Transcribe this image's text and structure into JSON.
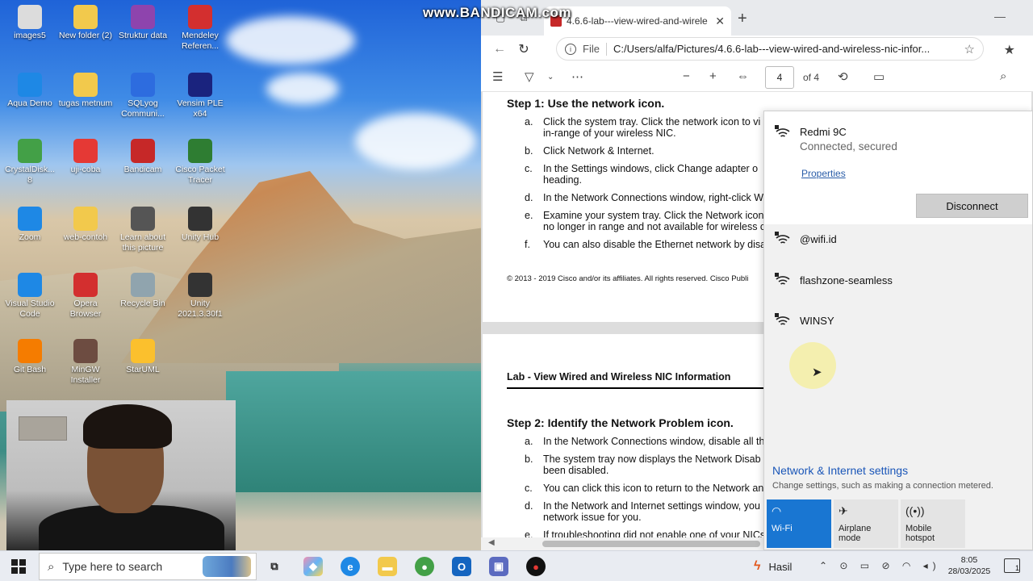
{
  "desktop": {
    "icons": [
      {
        "label": "images5",
        "icon": "image-icon",
        "color": "#dcdcdc"
      },
      {
        "label": "New folder (2)",
        "icon": "folder-icon",
        "color": "#f2c94c"
      },
      {
        "label": "Struktur data",
        "icon": "winrar-icon",
        "color": "#8e44ad"
      },
      {
        "label": "Mendeley Referen...",
        "icon": "mendeley-icon",
        "color": "#d32f2f"
      },
      {
        "label": "Aqua Demo",
        "icon": "aqua-icon",
        "color": "#1e88e5"
      },
      {
        "label": "tugas metnum",
        "icon": "folder-icon",
        "color": "#f2c94c"
      },
      {
        "label": "SQLyog Communi...",
        "icon": "sqlyog-icon",
        "color": "#2d6cdf"
      },
      {
        "label": "Vensim PLE x64",
        "icon": "vensim-icon",
        "color": "#1a237e"
      },
      {
        "label": "CrystalDisk... 8",
        "icon": "crystaldisk-icon",
        "color": "#43a047"
      },
      {
        "label": "uji-coba",
        "icon": "pdf-icon",
        "color": "#e53935"
      },
      {
        "label": "Bandicam",
        "icon": "bandicam-icon",
        "color": "#c62828"
      },
      {
        "label": "Cisco Packet Tracer",
        "icon": "packet-tracer-icon",
        "color": "#2e7d32"
      },
      {
        "label": "Zoom",
        "icon": "zoom-icon",
        "color": "#1e88e5"
      },
      {
        "label": "web-contoh",
        "icon": "folder-icon",
        "color": "#f2c94c"
      },
      {
        "label": "Learn about this picture",
        "icon": "camera-icon",
        "color": "#555555"
      },
      {
        "label": "Unity Hub",
        "icon": "unity-hub-icon",
        "color": "#333333"
      },
      {
        "label": "Visual Studio Code",
        "icon": "vscode-icon",
        "color": "#1e88e5"
      },
      {
        "label": "Opera Browser",
        "icon": "opera-icon",
        "color": "#d32f2f"
      },
      {
        "label": "Recycle Bin",
        "icon": "recycle-bin-icon",
        "color": "#90a4ae"
      },
      {
        "label": "Unity 2021.3.30f1",
        "icon": "unity-icon",
        "color": "#333333"
      },
      {
        "label": "Git Bash",
        "icon": "git-bash-icon",
        "color": "#f57c00"
      },
      {
        "label": "MinGW Installer",
        "icon": "mingw-icon",
        "color": "#6d4c41"
      },
      {
        "label": "StarUML",
        "icon": "staruml-icon",
        "color": "#fbc02d"
      }
    ],
    "watermark": "www.BANDICAM.com"
  },
  "browser": {
    "tab_title": "4.6.6-lab---view-wired-and-wirele",
    "address_scheme": "File",
    "address_url": "C:/Users/alfa/Pictures/4.6.6-lab---view-wired-and-wireless-nic-infor...",
    "page_number": "4",
    "page_total": "of 4"
  },
  "document": {
    "step1_title": "Step 1: Use the network icon.",
    "step1_items": [
      {
        "letter": "a.",
        "text": "Click the system tray. Click the network icon to vi"
      },
      {
        "letter": "",
        "text": "in-range of your wireless NIC."
      },
      {
        "letter": "b.",
        "text": "Click Network & Internet."
      },
      {
        "letter": "c.",
        "text": "In the Settings windows, click Change adapter o"
      },
      {
        "letter": "",
        "text": "heading."
      },
      {
        "letter": "d.",
        "text": "In the Network Connections window, right-click W"
      },
      {
        "letter": "e.",
        "text": "Examine your system tray. Click the Network icon"
      },
      {
        "letter": "",
        "text": "no longer in range and not available for wireless c"
      },
      {
        "letter": "f.",
        "text": "You can also disable the Ethernet network by disa"
      }
    ],
    "copyright": "© 2013 - 2019 Cisco and/or its affiliates. All rights reserved. Cisco Publi",
    "lab_title": "Lab - View Wired and Wireless NIC Information",
    "step2_title": "Step 2: Identify the Network Problem icon.",
    "step2_items": [
      {
        "letter": "a.",
        "text": "In the Network Connections window, disable all th"
      },
      {
        "letter": "b.",
        "text": "The system tray now displays the Network Disab"
      },
      {
        "letter": "",
        "text": "been disabled."
      },
      {
        "letter": "c.",
        "text": "You can click this icon to return to the Network an"
      },
      {
        "letter": "d.",
        "text": "In the Network and Internet settings window, you"
      },
      {
        "letter": "",
        "text": "network issue for you."
      },
      {
        "letter": "e.",
        "text": "If troubleshooting did not enable one of your NICs"
      }
    ]
  },
  "wifi": {
    "connected_name": "Redmi 9C",
    "connected_status": "Connected, secured",
    "properties_label": "Properties",
    "disconnect_label": "Disconnect",
    "networks": [
      "@wifi.id",
      "flashzone-seamless",
      "WINSY"
    ],
    "settings_title": "Network & Internet settings",
    "settings_sub": "Change settings, such as making a connection metered.",
    "quick_actions": [
      {
        "label": "Wi-Fi",
        "active": true
      },
      {
        "label": "Airplane mode",
        "active": false
      },
      {
        "label": "Mobile hotspot",
        "active": false
      }
    ]
  },
  "taskbar": {
    "search_placeholder": "Type here to search",
    "hasil_label": "Hasil",
    "time": "8:05",
    "date": "28/03/2025",
    "notification_count": "1"
  }
}
